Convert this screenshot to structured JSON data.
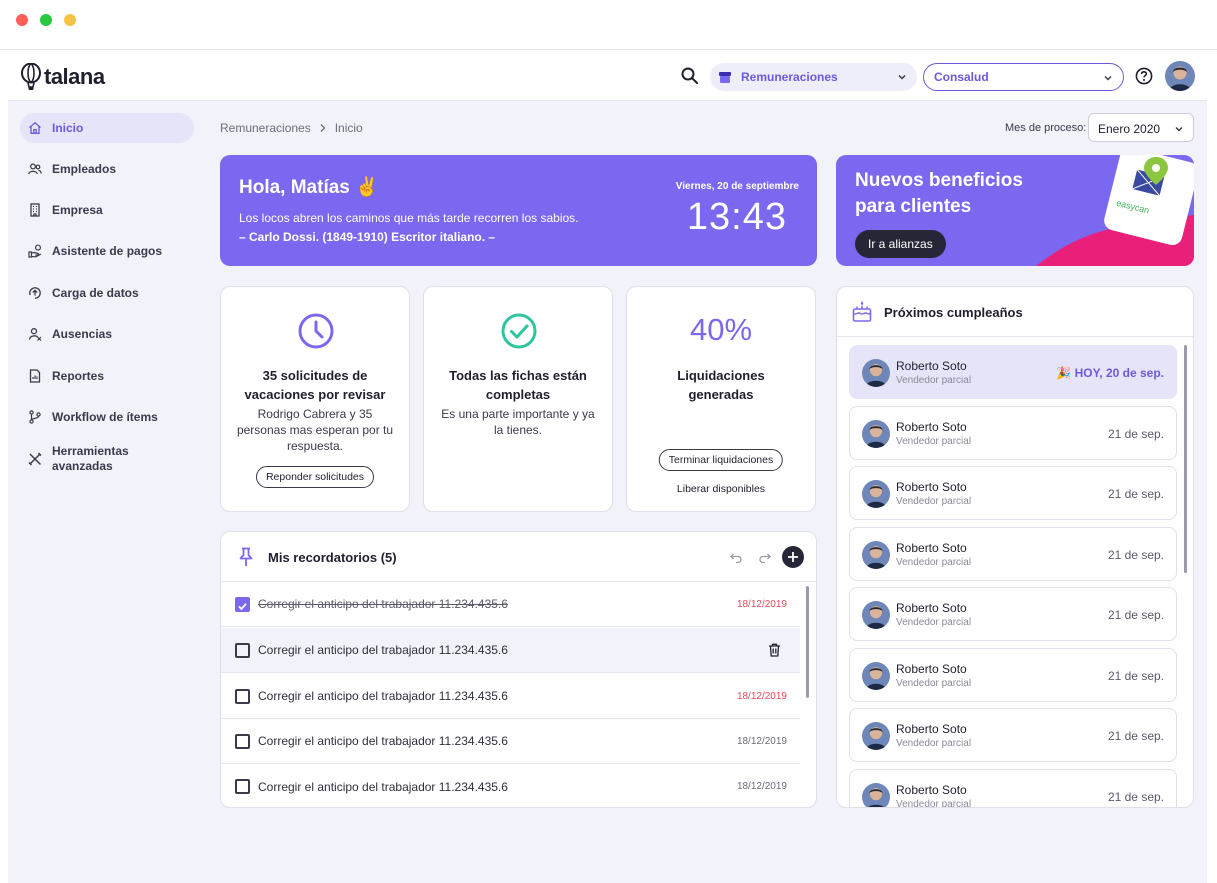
{
  "window": {
    "dots": [
      "#ff5f57",
      "#28c840",
      "#f5c242"
    ]
  },
  "brand": {
    "name": "talana",
    "accent": "#7b68f0",
    "dark": "#262636",
    "late": "#e64c5a"
  },
  "topbar": {
    "module_select": "Remuneraciones",
    "company_select": "Consalud"
  },
  "sidebar": {
    "items": [
      {
        "label": "Inicio",
        "icon": "home-icon"
      },
      {
        "label": "Empleados",
        "icon": "users-icon"
      },
      {
        "label": "Empresa",
        "icon": "building-icon"
      },
      {
        "label": "Asistente de pagos",
        "icon": "payment-icon"
      },
      {
        "label": "Carga de datos",
        "icon": "upload-icon"
      },
      {
        "label": "Ausencias",
        "icon": "absence-icon"
      },
      {
        "label": "Reportes",
        "icon": "report-icon"
      },
      {
        "label": "Workflow de ítems",
        "icon": "workflow-icon"
      },
      {
        "label": "Herramientas avanzadas",
        "icon": "tools-icon"
      }
    ]
  },
  "breadcrumb": {
    "root": "Remuneraciones",
    "current": "Inicio"
  },
  "process": {
    "label": "Mes de proceso:",
    "value": "Enero 2020"
  },
  "greeting": {
    "title": "Hola, Matías ✌️",
    "quote": "Los locos abren los caminos que más tarde recorren los sabios.",
    "author": "– Carlo Dossi. (1849-1910) Escritor italiano. –",
    "date": "Viernes, 20 de septiembre",
    "time": "13:43"
  },
  "promo": {
    "title": "Nuevos beneficios para clientes",
    "button": "Ir a alianzas",
    "art_text": "easycan"
  },
  "cards": {
    "vacations": {
      "title": "35 solicitudes de vacaciones por revisar",
      "desc": "Rodrigo Cabrera y 35 personas mas esperan por tu respuesta.",
      "button": "Reponder solicitudes"
    },
    "records": {
      "title": "Todas las fichas están completas",
      "desc": "Es una parte importante y ya la tienes."
    },
    "payroll": {
      "pct": "40%",
      "title": "Liquidaciones generadas",
      "button": "Terminar liquidaciones",
      "link": "Liberar disponibles"
    }
  },
  "reminders": {
    "title": "Mis recordatorios (5)",
    "items": [
      {
        "text": "Corregir el anticipo del trabajador 11.234.435.6",
        "date": "18/12/2019",
        "done": true,
        "late": true
      },
      {
        "text": "Corregir el anticipo del trabajador 11.234.435.6",
        "date": "",
        "done": false,
        "late": false
      },
      {
        "text": "Corregir el anticipo del trabajador 11.234.435.6",
        "date": "18/12/2019",
        "done": false,
        "late": true
      },
      {
        "text": "Corregir el anticipo del trabajador 11.234.435.6",
        "date": "18/12/2019",
        "done": false,
        "late": false
      },
      {
        "text": "Corregir el anticipo del trabajador 11.234.435.6",
        "date": "18/12/2019",
        "done": false,
        "late": false
      }
    ]
  },
  "birthdays": {
    "title": "Próximos cumpleaños",
    "items": [
      {
        "name": "Roberto Soto",
        "role": "Vendedor parcial",
        "date": "🎉 HOY, 20 de sep.",
        "today": true
      },
      {
        "name": "Roberto Soto",
        "role": "Vendedor parcial",
        "date": "21 de sep.",
        "today": false
      },
      {
        "name": "Roberto Soto",
        "role": "Vendedor parcial",
        "date": "21 de sep.",
        "today": false
      },
      {
        "name": "Roberto Soto",
        "role": "Vendedor parcial",
        "date": "21 de sep.",
        "today": false
      },
      {
        "name": "Roberto Soto",
        "role": "Vendedor parcial",
        "date": "21 de sep.",
        "today": false
      },
      {
        "name": "Roberto Soto",
        "role": "Vendedor parcial",
        "date": "21 de sep.",
        "today": false
      },
      {
        "name": "Roberto Soto",
        "role": "Vendedor parcial",
        "date": "21 de sep.",
        "today": false
      },
      {
        "name": "Roberto Soto",
        "role": "Vendedor parcial",
        "date": "21 de sep.",
        "today": false
      }
    ]
  }
}
